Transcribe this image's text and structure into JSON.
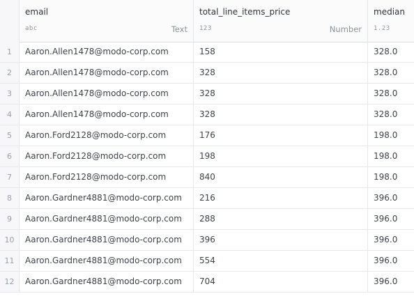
{
  "columns": [
    {
      "name": "email",
      "type_icon": "abc",
      "type_label": "Text"
    },
    {
      "name": "total_line_items_price",
      "type_icon": "123",
      "type_label": "Number"
    },
    {
      "name": "median",
      "type_icon": "1.23",
      "type_label": ""
    }
  ],
  "rows": [
    {
      "num": "1",
      "email": "Aaron.Allen1478@modo-corp.com",
      "total": "158",
      "median": "328.0"
    },
    {
      "num": "2",
      "email": "Aaron.Allen1478@modo-corp.com",
      "total": "328",
      "median": "328.0"
    },
    {
      "num": "3",
      "email": "Aaron.Allen1478@modo-corp.com",
      "total": "328",
      "median": "328.0"
    },
    {
      "num": "4",
      "email": "Aaron.Allen1478@modo-corp.com",
      "total": "328",
      "median": "328.0"
    },
    {
      "num": "5",
      "email": "Aaron.Ford2128@modo-corp.com",
      "total": "176",
      "median": "198.0"
    },
    {
      "num": "6",
      "email": "Aaron.Ford2128@modo-corp.com",
      "total": "198",
      "median": "198.0"
    },
    {
      "num": "7",
      "email": "Aaron.Ford2128@modo-corp.com",
      "total": "840",
      "median": "198.0"
    },
    {
      "num": "8",
      "email": "Aaron.Gardner4881@modo-corp.com",
      "total": "216",
      "median": "396.0"
    },
    {
      "num": "9",
      "email": "Aaron.Gardner4881@modo-corp.com",
      "total": "288",
      "median": "396.0"
    },
    {
      "num": "10",
      "email": "Aaron.Gardner4881@modo-corp.com",
      "total": "396",
      "median": "396.0"
    },
    {
      "num": "11",
      "email": "Aaron.Gardner4881@modo-corp.com",
      "total": "554",
      "median": "396.0"
    },
    {
      "num": "12",
      "email": "Aaron.Gardner4881@modo-corp.com",
      "total": "704",
      "median": "396.0"
    }
  ]
}
